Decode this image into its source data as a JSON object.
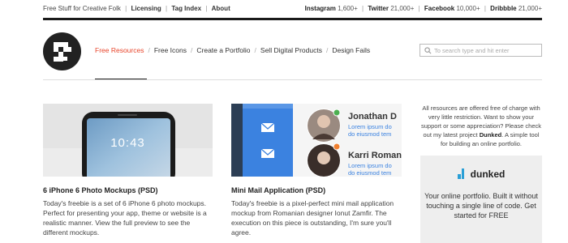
{
  "topbar": {
    "tagline": "Free Stuff for Creative Folk",
    "links": [
      "Licensing",
      "Tag Index",
      "About"
    ],
    "social": [
      {
        "name": "Instagram",
        "count": "1,600+"
      },
      {
        "name": "Twitter",
        "count": "21,000+"
      },
      {
        "name": "Facebook",
        "count": "10,000+"
      },
      {
        "name": "Dribbble",
        "count": "21,000+"
      }
    ]
  },
  "nav": {
    "items": [
      "Free Resources",
      "Free Icons",
      "Create a Portfolio",
      "Sell Digital Products",
      "Design Fails"
    ],
    "active_index": 0
  },
  "search": {
    "placeholder": "To search type and hit enter"
  },
  "posts": [
    {
      "title": "6 iPhone 6 Photo Mockups (PSD)",
      "excerpt": "Today's freebie is a set of 6 iPhone 6 photo mockups. Perfect for presenting your app, theme or website is a realistic manner. View the full preview to see the different mockups.",
      "thumb_time": "10:43"
    },
    {
      "title": "Mini Mail Application (PSD)",
      "excerpt": "Today's freebie is a pixel-perfect mini mail application mockup from Romanian designer Ionut Zamfir. The execution on this piece is outstanding, I'm sure you'll agree.",
      "contacts": [
        {
          "name": "Jonathan D",
          "line1": "Lorem ipsum do",
          "line2": "do eiusmod tem",
          "status_color": "#4caf50"
        },
        {
          "name": "Karri Roman",
          "line1": "Lorem ipsum do",
          "line2": "do eiusmod tem",
          "status_color": "#f08030"
        }
      ]
    }
  ],
  "sidebar": {
    "text_before": "All resources are offered free of charge with very little restriction. Want to show your support or some appreciation? Please check out my latest project ",
    "project": "Dunked",
    "text_after": ". A simple tool for building an online portfolio.",
    "ad": {
      "brand": "dunked",
      "tagline": "Your online portfolio. Built it without touching a single line of code. Get started for FREE"
    }
  },
  "colors": {
    "accent": "#e8452b",
    "mail_blue": "#3b82e0",
    "dark": "#1a1a1a"
  }
}
